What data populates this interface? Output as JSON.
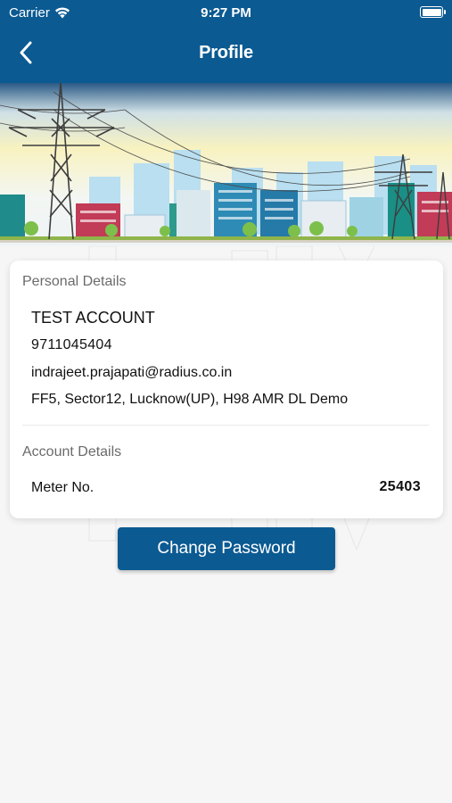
{
  "status_bar": {
    "carrier": "Carrier",
    "time": "9:27 PM",
    "wifi_icon": "wifi-icon",
    "battery_icon": "battery-icon"
  },
  "nav": {
    "back_icon": "chevron-left-icon",
    "title": "Profile"
  },
  "banner": {
    "illustration": "city-power-grid-illustration"
  },
  "personal_details": {
    "title": "Personal Details",
    "name": "TEST ACCOUNT",
    "phone": "9711045404",
    "email": "indrajeet.prajapati@radius.co.in",
    "address": "FF5, Sector12, Lucknow(UP), H98 AMR DL Demo"
  },
  "account_details": {
    "title": "Account Details",
    "meter_label": "Meter No.",
    "meter_value": "25403"
  },
  "actions": {
    "change_password_label": "Change Password"
  },
  "colors": {
    "primary": "#0b5a92",
    "background": "#f6f6f6",
    "card": "#ffffff"
  }
}
